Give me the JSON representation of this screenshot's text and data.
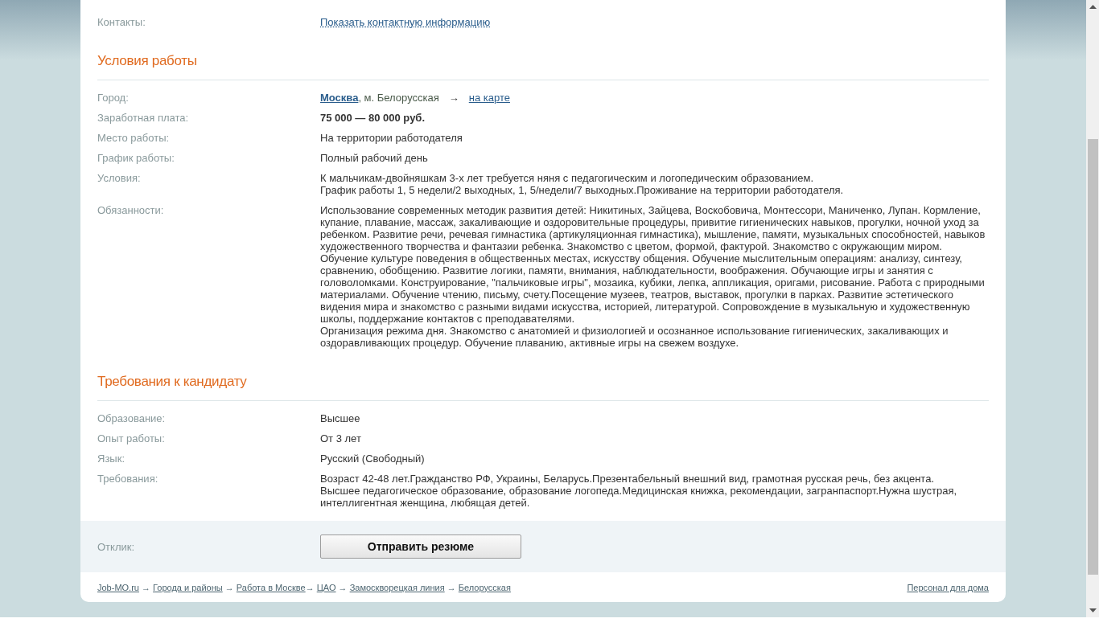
{
  "contacts": {
    "label": "Контакты:",
    "link": "Показать контактную информацию"
  },
  "sections": [
    {
      "title": "Условия работы",
      "rows": [
        {
          "kind": "city",
          "label": "Город:",
          "city": "Москва",
          "rest": ", м. Белорусская",
          "arrow": "→",
          "link": "на карте"
        },
        {
          "kind": "bold",
          "label": "Заработная плата:",
          "value": "75 000 — 80 000 руб."
        },
        {
          "kind": "text",
          "label": "Место работы:",
          "value": "На территории работодателя"
        },
        {
          "kind": "text",
          "label": "График работы:",
          "value": "Полный рабочий день"
        },
        {
          "kind": "text",
          "label": "Условия:",
          "value": "К мальчикам-двойняшкам 3-х лет требуется няня с педагогическим и логопедическим образованием.\nГрафик работы 1, 5 недели/2 выходных, 1, 5/недели/7 выходных.Проживание на территории работодателя."
        },
        {
          "kind": "text",
          "label": "Обязанности:",
          "value": "Использование современных методик развития детей: Никитиных, Зайцева, Воскобовича, Монтессори, Маниченко, Лупан. Кормление, купание, плавание, массаж, закаливающие и оздоровительные процедуры, привитие гигиенических навыков, прогулки, ночной уход за ребенком. Развитие речи, речевая гимнастика (артикуляционная гимнастика), мышление, памяти, музыкальных способностей, навыков художественного творчества и фантазии ребенка. Знакомство с цветом, формой, фактурой. Знакомство с окружающим миром. Обучение культуре поведения в общественных местах, искусству общения. Обучение мыслительным операциям: анализу, синтезу, сравнению, обобщению. Развитие логики, памяти, внимания, наблюдательности, воображения. Обучающие игры и занятия с головоломками. Конструирование, \"пальчиковые игры\", мозаика, кубики, лепка, аппликация, оригами, рисование. Работа с природными материалами. Обучение чтению, письму, счету.Посещение музеев, театров, выставок, прогулки в парках. Развитие эстетического видения мира и знакомство с разными видами искусства, историей, литературой. Сопровождение в музыкальную и художественную школы, поддержание контактов с преподавателями.\nОрганизация режима дня. Знакомство с анатомией и физиологией и осознанное использование гигиенических, закаливающих и оздоравливающих процедур. Обучение плаванию, активные игры на свежем воздухе."
        }
      ]
    },
    {
      "title": "Требования к кандидату",
      "rows": [
        {
          "kind": "text",
          "label": "Образование:",
          "value": "Высшее"
        },
        {
          "kind": "text",
          "label": "Опыт работы:",
          "value": "От 3 лет"
        },
        {
          "kind": "text",
          "label": "Язык:",
          "value": "Русский (Свободный)"
        },
        {
          "kind": "text",
          "label": "Требования:",
          "value": "Возраст 42-48 лет.Гражданство РФ, Украины, Беларусь.Презентабельный внешний вид, грамотная русская речь, без акцента.\nВысшее педагогическое образование, образование логопеда.Медицинская книжка, рекомендации, загранпаспорт.Нужна шустрая, интеллигентная женщина, любящая детей."
        }
      ]
    }
  ],
  "response": {
    "label": "Отклик:",
    "button": "Отправить резюме"
  },
  "breadcrumb": [
    {
      "label": "Job-MO.ru",
      "sep": " → "
    },
    {
      "label": "Города и районы",
      "sep": " → "
    },
    {
      "label": "Работа в Москве",
      "sep": "→ "
    },
    {
      "label": "ЦАО",
      "sep": " → "
    },
    {
      "label": "Замоскворецкая линия",
      "sep": " → "
    },
    {
      "label": "Белорусская"
    }
  ],
  "footer_link": "Персонал для дома"
}
